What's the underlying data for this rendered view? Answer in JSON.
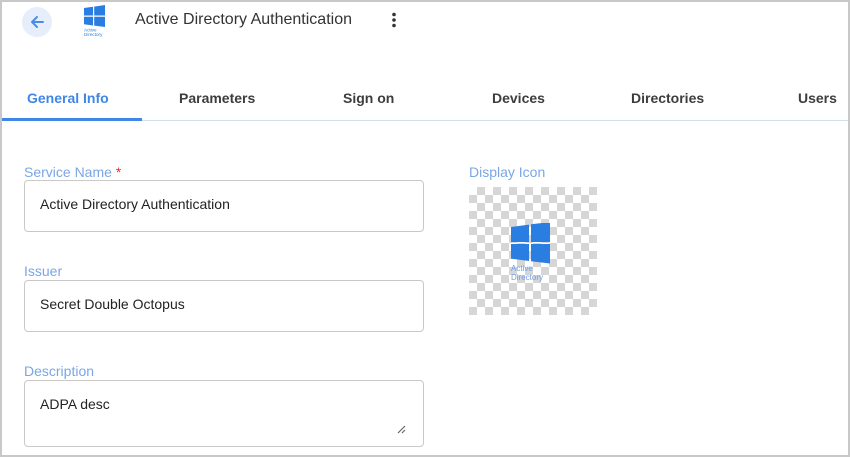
{
  "header": {
    "title": "Active Directory Authentication",
    "logo_text_line1": "Active",
    "logo_text_line2": "Directory",
    "back_icon": "arrow-left-icon",
    "menu_icon": "more-vert-icon"
  },
  "tabs": [
    {
      "label": "General Info",
      "active": true
    },
    {
      "label": "Parameters",
      "active": false
    },
    {
      "label": "Sign on",
      "active": false
    },
    {
      "label": "Devices",
      "active": false
    },
    {
      "label": "Directories",
      "active": false
    },
    {
      "label": "Users",
      "active": false
    }
  ],
  "form": {
    "service_name": {
      "label": "Service Name",
      "required_mark": "*",
      "value": "Active Directory Authentication"
    },
    "issuer": {
      "label": "Issuer",
      "value": "Secret Double Octopus"
    },
    "description": {
      "label": "Description",
      "value": "ADPA desc"
    }
  },
  "display_icon": {
    "label": "Display Icon",
    "icon_text_line1": "Active",
    "icon_text_line2": "Directory"
  },
  "colors": {
    "accent": "#3f87e6",
    "label": "#7aa6e6",
    "windows_blue": "#2a7de1"
  }
}
